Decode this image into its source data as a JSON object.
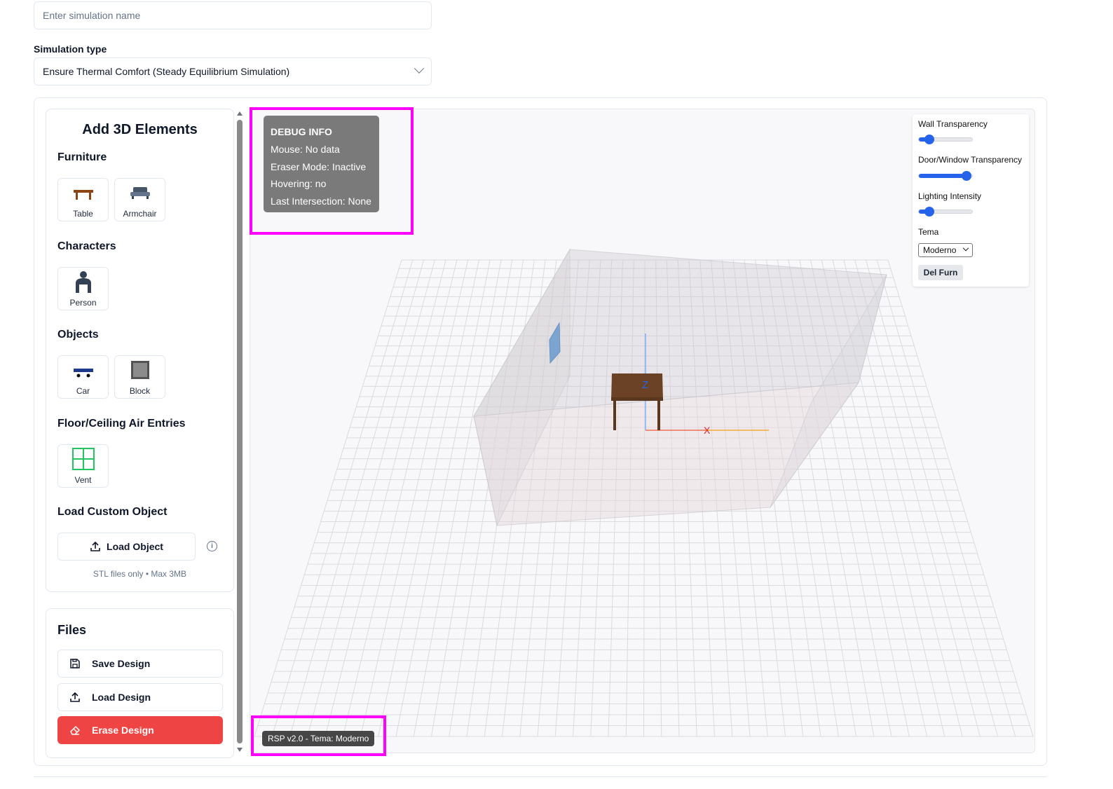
{
  "form": {
    "name_placeholder": "Enter simulation name",
    "sim_type_label": "Simulation type",
    "sim_type_value": "Ensure Thermal Comfort (Steady Equilibrium Simulation)"
  },
  "left_panel": {
    "title": "Add 3D Elements",
    "sections": {
      "furniture": "Furniture",
      "characters": "Characters",
      "objects": "Objects",
      "air_entries": "Floor/Ceiling Air Entries",
      "custom": "Load Custom Object"
    },
    "tiles": {
      "table": "Table",
      "armchair": "Armchair",
      "person": "Person",
      "car": "Car",
      "block": "Block",
      "vent": "Vent"
    },
    "load_object": "Load Object",
    "stl_note": "STL files only • Max 3MB"
  },
  "files": {
    "title": "Files",
    "save": "Save Design",
    "load": "Load Design",
    "erase": "Erase Design"
  },
  "debug": {
    "title": "DEBUG INFO",
    "mouse": "Mouse: No data",
    "eraser": "Eraser Mode: Inactive",
    "hovering": "Hovering: no",
    "intersection": "Last Intersection: None"
  },
  "controls": {
    "wall_transparency_label": "Wall Transparency",
    "wall_transparency_value": 0.2,
    "door_window_label": "Door/Window Transparency",
    "door_window_value": 0.9,
    "lighting_label": "Lighting Intensity",
    "lighting_value": 0.2,
    "tema_label": "Tema",
    "tema_value": "Moderno",
    "del_furn": "Del Furn"
  },
  "axes": {
    "x": "X",
    "z": "Z"
  },
  "version": "RSP v2.0 - Tema: Moderno",
  "colors": {
    "accent": "#2563eb",
    "danger": "#ef4444",
    "highlight": "#ff00ff",
    "table_wood": "#6b4226"
  }
}
